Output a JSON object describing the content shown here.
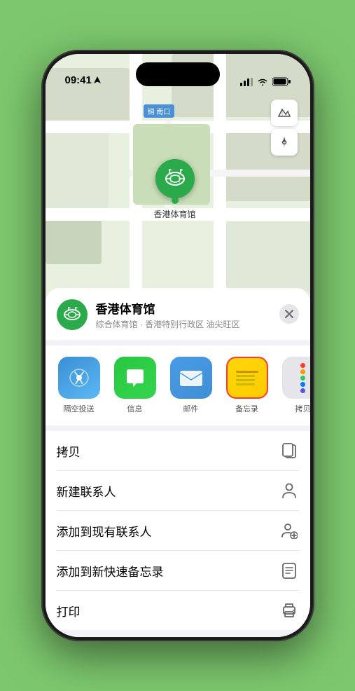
{
  "status_bar": {
    "time": "09:41",
    "location_arrow": true
  },
  "map": {
    "station_label": "南口",
    "station_prefix": "铜",
    "venue_name_map": "香港体育馆"
  },
  "sheet": {
    "venue_name": "香港体育馆",
    "venue_subtitle": "综合体育馆 · 香港特别行政区 油尖旺区",
    "close_label": "×"
  },
  "share_items": [
    {
      "id": "airdrop",
      "label": "隔空投送"
    },
    {
      "id": "messages",
      "label": "信息"
    },
    {
      "id": "mail",
      "label": "邮件"
    },
    {
      "id": "notes",
      "label": "备忘录"
    },
    {
      "id": "more",
      "label": "拷贝"
    }
  ],
  "actions": [
    {
      "id": "copy",
      "label": "拷贝",
      "icon": "copy"
    },
    {
      "id": "new-contact",
      "label": "新建联系人",
      "icon": "person"
    },
    {
      "id": "add-existing",
      "label": "添加到现有联系人",
      "icon": "person-add"
    },
    {
      "id": "add-notes",
      "label": "添加到新快速备忘录",
      "icon": "note"
    },
    {
      "id": "print",
      "label": "打印",
      "icon": "printer"
    }
  ],
  "more_dots_colors": [
    "#ff3b30",
    "#ff9500",
    "#34c759",
    "#007aff",
    "#5856d6"
  ]
}
